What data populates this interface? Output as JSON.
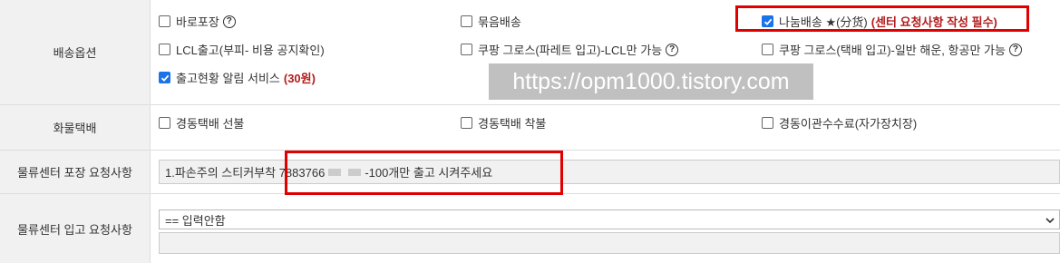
{
  "delivery_options": {
    "label": "배송옵션",
    "items": [
      {
        "label": "바로포장",
        "checked": false,
        "help": true
      },
      {
        "label": "묶음배송",
        "checked": false,
        "help": false
      },
      {
        "label": "나눔배송 ★(分货)",
        "note": "(센터 요청사항 작성 필수)",
        "checked": true,
        "help": false
      },
      {
        "label": "LCL출고(부피- 비용 공지확인)",
        "checked": false,
        "help": false
      },
      {
        "label": "쿠팡 그로스(파레트 입고)-LCL만 가능",
        "checked": false,
        "help": true
      },
      {
        "label": "쿠팡 그로스(택배 입고)-일반 해운, 항공만 가능",
        "checked": false,
        "help": true
      },
      {
        "label": "출고현황 알림 서비스",
        "note": "(30원)",
        "checked": true,
        "help": false
      }
    ]
  },
  "cargo_delivery": {
    "label": "화물택배",
    "items": [
      {
        "label": "경동택배 선불",
        "checked": false
      },
      {
        "label": "경동택배 착불",
        "checked": false
      },
      {
        "label": "경동이관수수료(자가장치장)",
        "checked": false
      }
    ]
  },
  "packing_request": {
    "label": "물류센터 포장 요청사항",
    "value_prefix": "1.파손주의 스티커부착 7883766",
    "value_suffix": "-100개만 출고 시켜주세요"
  },
  "receiving_request": {
    "label": "물류센터 입고 요청사항",
    "select_value": "== 입력안함",
    "textarea_value": ""
  },
  "watermark": "https://opm1000.tistory.com",
  "help_glyph": "?",
  "colors": {
    "accent": "#1a73e8",
    "highlight_red": "#e00000",
    "note_red": "#b31b1b",
    "label_bg": "#f1f1f1"
  }
}
